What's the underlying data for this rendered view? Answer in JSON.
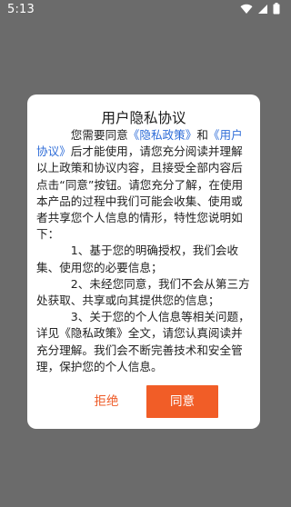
{
  "status_bar": {
    "time": "5:13",
    "icons": [
      "wifi-icon",
      "signal-icon",
      "battery-icon"
    ]
  },
  "dialog": {
    "title": "用户隐私协议",
    "p1": {
      "t1": "您需要同意",
      "link1": "《隐私政策》",
      "t2": "和",
      "link2": "《用户协议》",
      "t3": "后才能使用，请您充分阅读并理解以上政策和协议内容，且接受全部内容后点击“同意”按钮。请您充分了解，在使用本产品的过程中我们可能会收集、使用或者共享您个人信息的情形，特性您说明如下："
    },
    "item1": "1、基于您的明确授权，我们会收集、使用您的必要信息；",
    "item2": "2、未经您同意，我们不会从第三方处获取、共享或向其提供您的信息；",
    "item3": "3、关于您的个人信息等相关问题，详见《隐私政策》全文，请您认真阅读并充分理解。我们会不断完善技术和安全管理，保护您的个人信息。",
    "reject_label": "拒绝",
    "agree_label": "同意"
  },
  "colors": {
    "accent": "#f15d27",
    "link": "#2f6dd8",
    "overlay": "#6b6b6b"
  }
}
